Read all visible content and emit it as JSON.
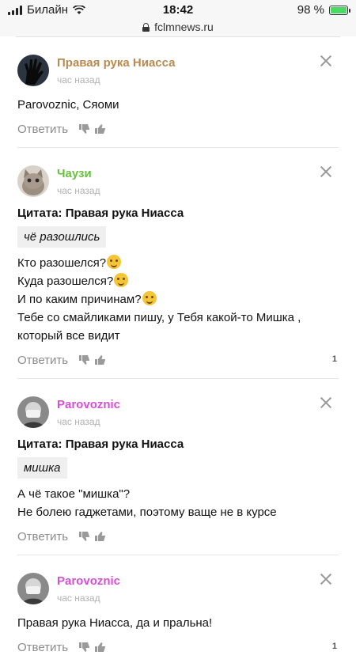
{
  "status_bar": {
    "carrier": "Билайн",
    "time": "18:42",
    "battery": "98 %",
    "battery_level": 0.98
  },
  "browser": {
    "url": "fclmnews.ru"
  },
  "comments": [
    {
      "author": "Правая рука Ниасса",
      "author_color": "#b98a4f",
      "time_ago": "час назад",
      "quote_title": "",
      "quote_text": "",
      "lines": [
        "Parovoznic, Сяоми"
      ],
      "reply_label": "Ответить",
      "score": ""
    },
    {
      "author": "Чаузи",
      "author_color": "#66c23a",
      "time_ago": "час назад",
      "quote_title": "Цитата: Правая рука Ниасса",
      "quote_text": "чё разошлись",
      "lines": [
        "Кто разошелся?",
        "Куда разошелся?",
        "И по каким причинам?",
        "Тебе со смайликами пишу, у Тебя какой-то Мишка ,",
        "который все видит"
      ],
      "reply_label": "Ответить",
      "score": "1"
    },
    {
      "author": "Parovoznic",
      "author_color": "#d64fd6",
      "time_ago": "час назад",
      "quote_title": "Цитата: Правая рука Ниасса",
      "quote_text": "мишка",
      "lines": [
        "А чё такое \"мишка\"?",
        "Не болею гаджетами, поэтому ваще не в курсе"
      ],
      "reply_label": "Ответить",
      "score": ""
    },
    {
      "author": "Parovoznic",
      "author_color": "#d64fd6",
      "time_ago": "час назад",
      "quote_title": "",
      "quote_text": "",
      "lines": [
        "Правая рука Ниасса, да и пральна!"
      ],
      "reply_label": "Ответить",
      "score": "1"
    }
  ]
}
